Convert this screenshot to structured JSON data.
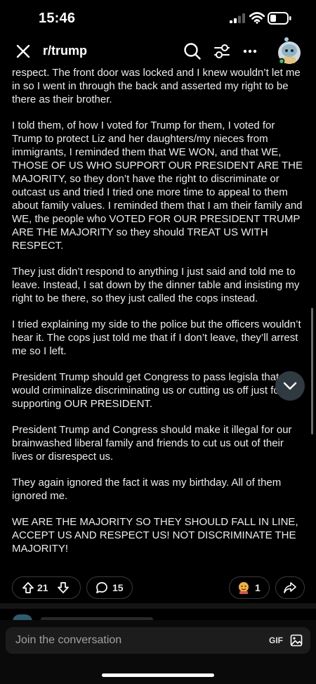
{
  "status_bar": {
    "time": "15:46"
  },
  "nav": {
    "title": "r/trump"
  },
  "post": {
    "paragraphs": [
      "respect. The front door was locked and I knew wouldn’t let me in so I went in through the back and asserted my right to be there as their brother.",
      "I told them, of how I voted for Trump for them, I voted for Trump to protect Liz and her daughters/my nieces from immigrants, I reminded them that WE WON, and that WE, THOSE OF US WHO SUPPORT OUR PRESIDENT ARE THE MAJORITY, so they don’t have the right to discriminate or outcast us and tried I tried one more time to appeal to them about family values. I reminded them that I am their family and WE, the people who VOTED FOR OUR PRESIDENT TRUMP ARE THE MAJORITY so they should TREAT US WITH RESPECT.",
      "They just didn’t respond to anything I just said and told me to leave. Instead, I sat down by the dinner table and insisting my right to be there, so they just called the cops instead.",
      "I tried explaining my side to the police but the officers wouldn’t hear it. The cops just told me that if I don’t leave, they’ll arrest me so I left.",
      "President Trump should get Congress to pass legisla that would criminalize discriminating us or cutting us off just for supporting OUR PRESIDENT.",
      "President Trump and Congress should make it illegal for our brainwashed liberal family and friends to cut us out of their lives or disrespect us.",
      "They again ignored the fact it was my birthday. All of them ignored me.",
      "WE ARE THE MAJORITY SO THEY SHOULD FALL IN LINE, ACCEPT US AND RESPECT US! NOT DISCRIMINATE THE MAJORITY!"
    ]
  },
  "actions": {
    "upvotes": "21",
    "comments": "15",
    "awards": "1"
  },
  "compose": {
    "placeholder": "Join the conversation",
    "gif_label": "GIF"
  },
  "icons": [
    "close-icon",
    "search-icon",
    "filter-icon",
    "more-icon",
    "avatar",
    "upvote-icon",
    "downvote-icon",
    "comment-icon",
    "award-icon",
    "share-icon",
    "chevron-down-icon",
    "image-icon"
  ],
  "colors": {
    "background": "#000000",
    "text": "#ececec",
    "online_dot": "#2ecc71",
    "scroll_button": "#2f3b40"
  }
}
